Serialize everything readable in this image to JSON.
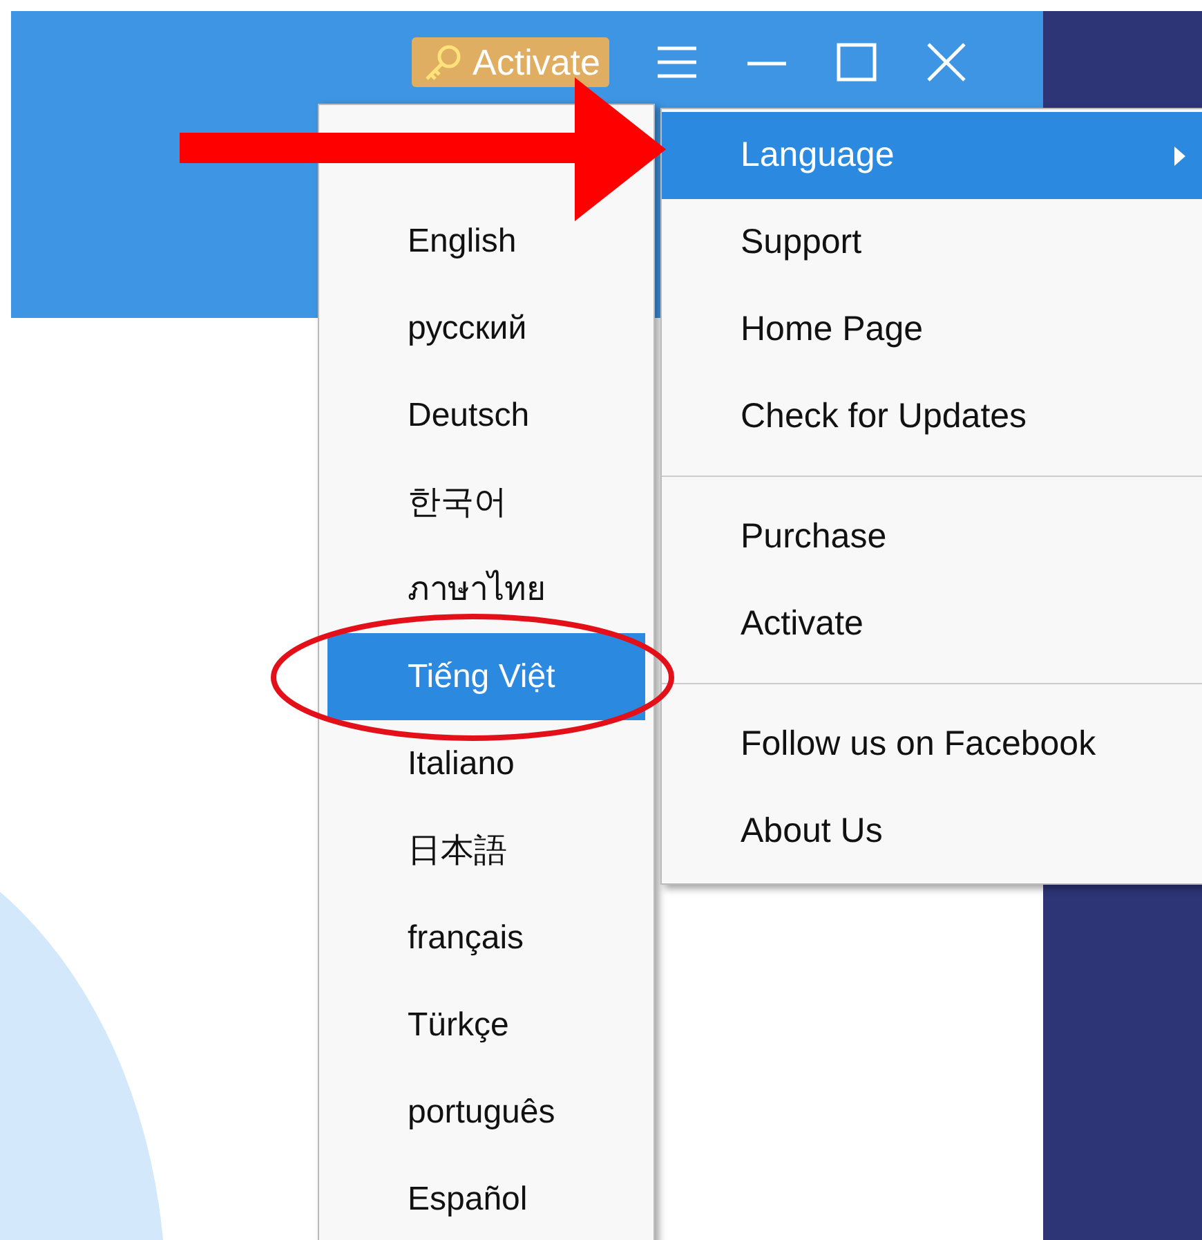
{
  "title_bar": {
    "activate_button": "Activate"
  },
  "language_menu": {
    "items": [
      {
        "label": "English",
        "selected": false
      },
      {
        "label": "русский",
        "selected": false
      },
      {
        "label": "Deutsch",
        "selected": false
      },
      {
        "label": "한국어",
        "selected": false
      },
      {
        "label": "ภาษาไทย",
        "selected": false
      },
      {
        "label": "Tiếng Việt",
        "selected": true
      },
      {
        "label": "Italiano",
        "selected": false
      },
      {
        "label": "日本語",
        "selected": false
      },
      {
        "label": "français",
        "selected": false
      },
      {
        "label": "Türkçe",
        "selected": false
      },
      {
        "label": "português",
        "selected": false
      },
      {
        "label": "Español",
        "selected": false
      }
    ]
  },
  "main_menu": {
    "groups": [
      [
        {
          "label": "Language",
          "selected": true,
          "submenu": true
        },
        {
          "label": "Support",
          "selected": false,
          "submenu": false
        },
        {
          "label": "Home Page",
          "selected": false,
          "submenu": false
        },
        {
          "label": "Check for Updates",
          "selected": false,
          "submenu": false
        }
      ],
      [
        {
          "label": "Purchase",
          "selected": false,
          "submenu": false
        },
        {
          "label": "Activate",
          "selected": false,
          "submenu": false
        }
      ],
      [
        {
          "label": "Follow us on Facebook",
          "selected": false,
          "submenu": false
        },
        {
          "label": "About Us",
          "selected": false,
          "submenu": false
        }
      ]
    ]
  }
}
